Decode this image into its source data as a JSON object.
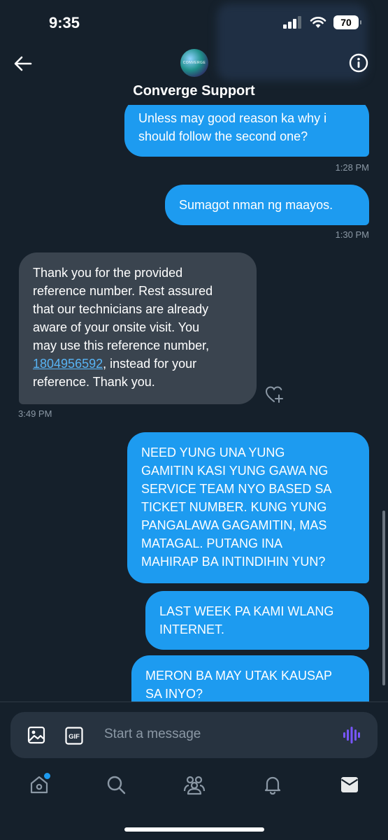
{
  "status": {
    "time": "9:35",
    "battery": "70"
  },
  "header": {
    "title": "Converge Support",
    "avatar_text": "CONVERGE"
  },
  "messages": [
    {
      "type": "outgoing",
      "lines": [
        "Unless may good reason ka why i",
        "should follow the second one?"
      ],
      "time": "1:28 PM"
    },
    {
      "type": "outgoing",
      "lines": [
        "Sumagot nman ng maayos."
      ],
      "time": "1:30 PM"
    },
    {
      "type": "incoming",
      "lines": [
        "Thank you for the provided",
        "reference number. Rest assured",
        "that our technicians are already",
        "aware of your onsite visit. You",
        "may use this reference number,",
        "1804956592",
        ", instead for your",
        "reference. Thank you."
      ],
      "time": "3:49 PM"
    },
    {
      "type": "outgoing",
      "lines": [
        "NEED YUNG UNA YUNG",
        "GAMITIN KASI YUNG GAWA NG",
        "SERVICE TEAM NYO BASED SA",
        "TICKET NUMBER. KUNG YUNG",
        "PANGALAWA GAGAMITIN, MAS",
        "MATAGAL. PUTANG INA",
        "MAHIRAP BA INTINDIHIN YUN?"
      ]
    },
    {
      "type": "outgoing",
      "lines": [
        "LAST WEEK PA KAMI WLANG",
        "INTERNET."
      ]
    },
    {
      "type": "outgoing",
      "lines": [
        "MERON BA MAY UTAK KAUSAP",
        "SA INYO?"
      ]
    }
  ],
  "composer": {
    "placeholder": "Start a message",
    "gif_label": "GIF"
  },
  "colors": {
    "background": "#15202b",
    "outgoing": "#1d9bf0",
    "incoming": "#3a444f",
    "voice": "#7856ff"
  },
  "icons": [
    "back-arrow-icon",
    "info-icon",
    "heart-add-icon",
    "image-icon",
    "gif-icon",
    "voice-icon",
    "home-icon",
    "search-icon",
    "communities-icon",
    "notifications-icon",
    "messages-icon"
  ]
}
